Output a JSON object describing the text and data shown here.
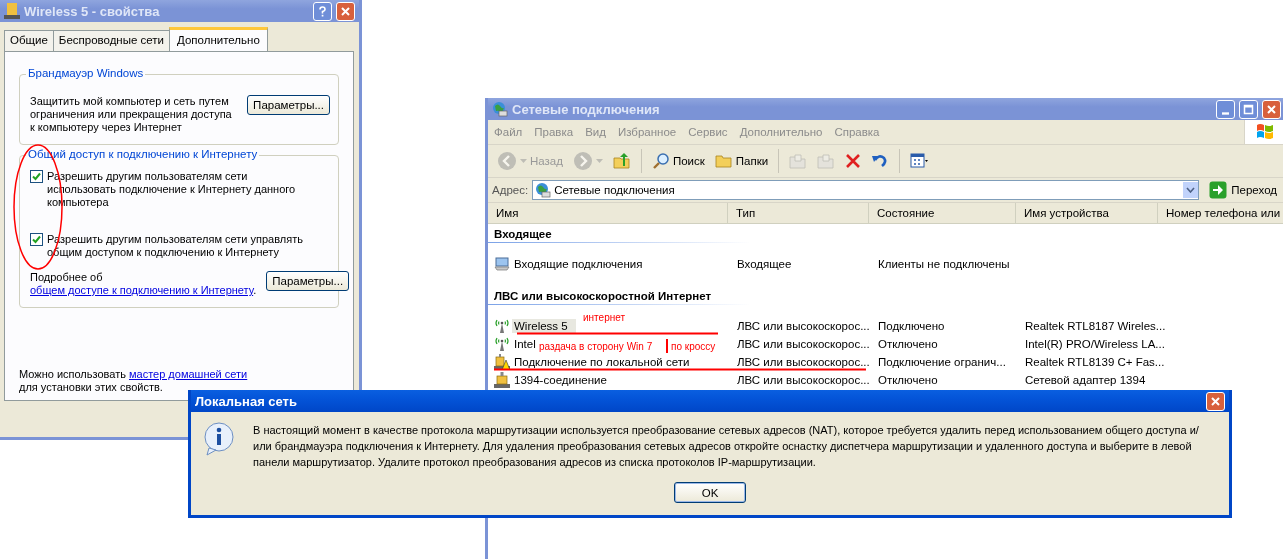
{
  "properties_dialog": {
    "title": "Wireless 5 - свойства",
    "tabs": [
      {
        "label": "Общие",
        "selected": false
      },
      {
        "label": "Беспроводные сети",
        "selected": false
      },
      {
        "label": "Дополнительно",
        "selected": true
      }
    ],
    "firewall_group": {
      "title": "Брандмауэр Windows",
      "text": "Защитить мой компьютер и сеть путем ограничения или прекращения доступа к компьютеру через Интернет",
      "button": "Параметры..."
    },
    "ics_group": {
      "title": "Общий доступ к подключению к Интернету",
      "options": [
        {
          "label": "Разрешить другим пользователям сети использовать подключение к Интернету данного компьютера",
          "checked": true
        },
        {
          "label": "Разрешить другим пользователям сети управлять общим доступом к подключению к Интернету",
          "checked": true
        }
      ],
      "more_text": "Подробнее об",
      "more_link": "общем доступе к подключению к Интернету",
      "more_suffix": ".",
      "button": "Параметры..."
    },
    "footer_text": "Можно использовать",
    "footer_link": "мастер домашней сети",
    "footer_suffix": "для установки этих свойств."
  },
  "explorer": {
    "title": "Сетевые подключения",
    "menu": [
      "Файл",
      "Правка",
      "Вид",
      "Избранное",
      "Сервис",
      "Дополнительно",
      "Справка"
    ],
    "toolbar": [
      {
        "kind": "back",
        "label": "Назад",
        "disabled": true
      },
      {
        "kind": "forward",
        "disabled": true
      },
      {
        "kind": "up",
        "disabled": false
      },
      {
        "kind": "separator"
      },
      {
        "kind": "search",
        "label": "Поиск",
        "disabled": false
      },
      {
        "kind": "folders",
        "label": "Папки",
        "disabled": false
      },
      {
        "kind": "separator"
      },
      {
        "kind": "move",
        "disabled": true
      },
      {
        "kind": "copy",
        "disabled": true
      },
      {
        "kind": "delete",
        "disabled": false
      },
      {
        "kind": "undo",
        "disabled": false
      },
      {
        "kind": "separator"
      },
      {
        "kind": "views",
        "disabled": false
      }
    ],
    "address_label": "Адрес:",
    "address": "Сетевые подключения",
    "go": "Переход",
    "columns": [
      "Имя",
      "Тип",
      "Состояние",
      "Имя устройства",
      "Номер телефона или"
    ],
    "groups": [
      {
        "title": "Входящее",
        "items": [
          {
            "kind": "incoming",
            "name": "Входящие подключения",
            "type": "Входящее",
            "status": "Клиенты не подключены",
            "selected": false
          }
        ]
      },
      {
        "title": "ЛВС или высокоскоростной Интернет",
        "items": [
          {
            "kind": "wireless",
            "name": "Wireless 5",
            "type": "ЛВС или высокоскорос...",
            "status": "Подключено",
            "device": "Realtek RTL8187 Wireles...",
            "selected": true
          },
          {
            "kind": "wireless",
            "name": "Intel",
            "type": "ЛВС или высокоскорос...",
            "status": "Отключено",
            "device": "Intel(R) PRO/Wireless LA...",
            "selected": false
          },
          {
            "kind": "wired-warning",
            "name": "Подключение по локальной сети",
            "type": "ЛВС или высокоскорос...",
            "status": "Подключение огранич...",
            "device": "Realtek RTL8139 C+ Fas...",
            "selected": false
          },
          {
            "kind": "wired",
            "name": "1394-соединение",
            "type": "ЛВС или высокоскорос...",
            "status": "Отключено",
            "device": "Сетевой адаптер 1394",
            "selected": false
          }
        ]
      }
    ]
  },
  "annotations": {
    "internet": "интернет",
    "sharing": "раздача в сторону  Win 7",
    "cable": "по кроссу"
  },
  "message_box": {
    "title": "Локальная сеть",
    "text": "В настоящий момент в качестве протокола маршрутизации используется преобразование сетевых адресов (NAT), которое требуется удалить перед использованием общего доступа и/или брандмауэра подключения к Интернету. Для удаления преобразования сетевых адресов откройте оснастку диспетчера маршрутизации и удаленного доступа и выберите в левой панели маршрутизатор. Удалите протокол преобразования адресов из списка протоколов IP-маршрутизации.",
    "button": "OK"
  }
}
